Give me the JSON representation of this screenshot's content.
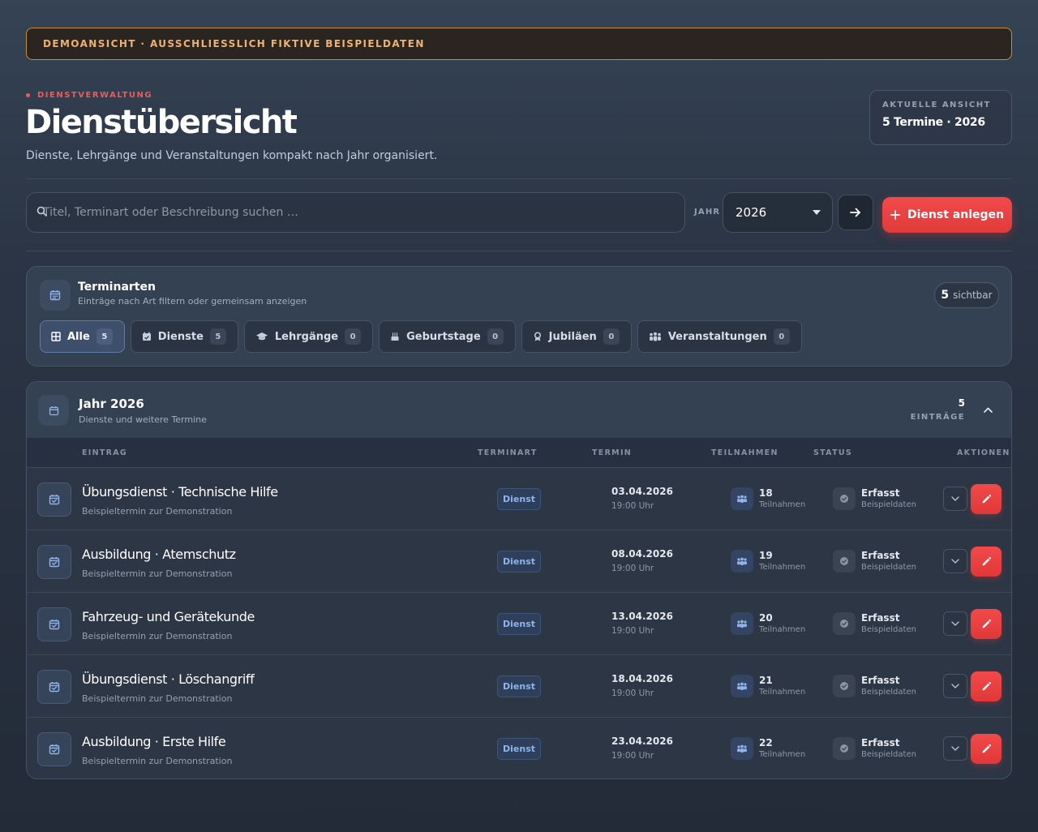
{
  "banner": {
    "text": "DEMOANSICHT · AUSSCHLIESSLICH FIKTIVE BEISPIELDATEN"
  },
  "header": {
    "eyebrow": "DIENSTVERWALTUNG",
    "title": "Dienstübersicht",
    "subtitle": "Dienste, Lehrgänge und Veranstaltungen kompakt nach Jahr organisiert.",
    "view_label": "AKTUELLE ANSICHT",
    "view_value": "5 Termine · 2026"
  },
  "toolbar": {
    "search_placeholder": "Titel, Terminart oder Beschreibung suchen …",
    "search_value": "",
    "year_label": "JAHR",
    "year_value": "2026",
    "create_label": "Dienst anlegen"
  },
  "types": {
    "title": "Terminarten",
    "subtitle": "Einträge nach Art filtern oder gemeinsam anzeigen",
    "visible_count": "5",
    "visible_label": "sichtbar",
    "filters": [
      {
        "label": "Alle",
        "count": "5",
        "icon": "grid-icon",
        "active": true
      },
      {
        "label": "Dienste",
        "count": "5",
        "icon": "calendar-check-icon",
        "active": false
      },
      {
        "label": "Lehrgänge",
        "count": "0",
        "icon": "graduation-cap-icon",
        "active": false
      },
      {
        "label": "Geburtstage",
        "count": "0",
        "icon": "birthday-cake-icon",
        "active": false
      },
      {
        "label": "Jubiläen",
        "count": "0",
        "icon": "award-icon",
        "active": false
      },
      {
        "label": "Veranstaltungen",
        "count": "0",
        "icon": "people-group-icon",
        "active": false
      }
    ]
  },
  "year_section": {
    "title": "Jahr 2026",
    "subtitle": "Dienste und weitere Termine",
    "count": "5",
    "count_label": "EINTRÄGE",
    "columns": {
      "entry": "EINTRAG",
      "type": "TERMINART",
      "date": "TERMIN",
      "participants": "TEILNAHMEN",
      "status": "STATUS",
      "actions": "AKTIONEN"
    },
    "rows": [
      {
        "title": "Übungsdienst · Technische Hilfe",
        "desc": "Beispieltermin zur Demonstration",
        "type": "Dienst",
        "date": "03.04.2026",
        "time": "19:00 Uhr",
        "participants": "18",
        "participants_label": "Teilnahmen",
        "status": "Erfasst",
        "status_sub": "Beispieldaten"
      },
      {
        "title": "Ausbildung · Atemschutz",
        "desc": "Beispieltermin zur Demonstration",
        "type": "Dienst",
        "date": "08.04.2026",
        "time": "19:00 Uhr",
        "participants": "19",
        "participants_label": "Teilnahmen",
        "status": "Erfasst",
        "status_sub": "Beispieldaten"
      },
      {
        "title": "Fahrzeug- und Gerätekunde",
        "desc": "Beispieltermin zur Demonstration",
        "type": "Dienst",
        "date": "13.04.2026",
        "time": "19:00 Uhr",
        "participants": "20",
        "participants_label": "Teilnahmen",
        "status": "Erfasst",
        "status_sub": "Beispieldaten"
      },
      {
        "title": "Übungsdienst · Löschangriff",
        "desc": "Beispieltermin zur Demonstration",
        "type": "Dienst",
        "date": "18.04.2026",
        "time": "19:00 Uhr",
        "participants": "21",
        "participants_label": "Teilnahmen",
        "status": "Erfasst",
        "status_sub": "Beispieldaten"
      },
      {
        "title": "Ausbildung · Erste Hilfe",
        "desc": "Beispieltermin zur Demonstration",
        "type": "Dienst",
        "date": "23.04.2026",
        "time": "19:00 Uhr",
        "participants": "22",
        "participants_label": "Teilnahmen",
        "status": "Erfasst",
        "status_sub": "Beispieldaten"
      }
    ]
  },
  "colors": {
    "accent_red": "#e53e3e",
    "banner_border": "#c98a3e",
    "badge_blue": "#8fb3ea"
  }
}
